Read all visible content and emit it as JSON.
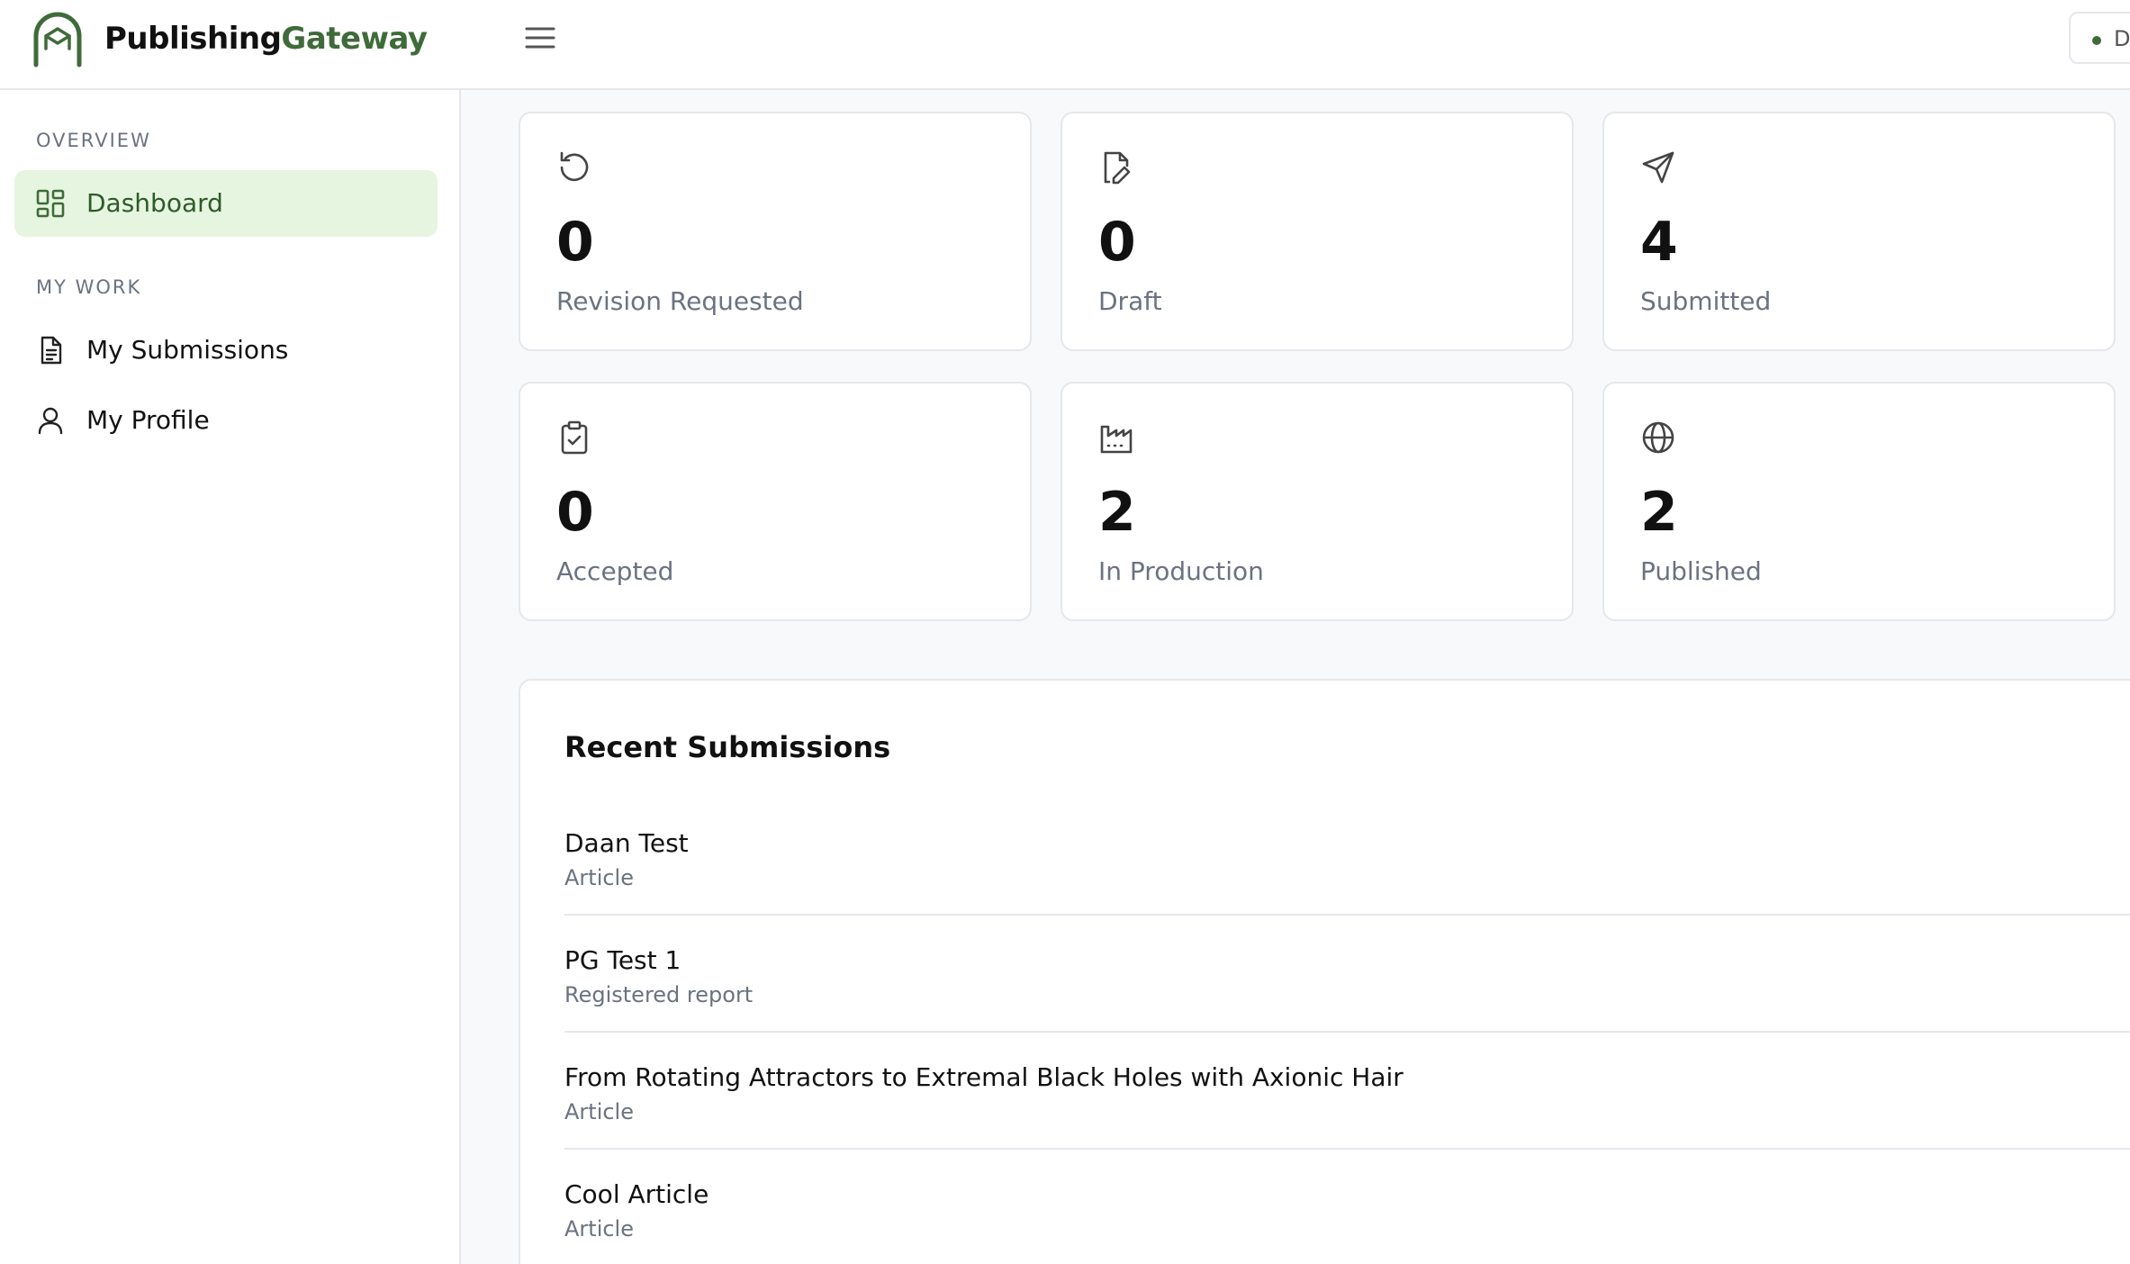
{
  "brand": {
    "name_part1": "Publishing",
    "name_part2": "Gateway",
    "accent": "#3f6b3a"
  },
  "header": {
    "status_text": "D"
  },
  "sidebar": {
    "sections": [
      {
        "label": "OVERVIEW",
        "items": [
          {
            "label": "Dashboard",
            "icon": "dashboard-grid-icon",
            "active": true
          }
        ]
      },
      {
        "label": "MY WORK",
        "items": [
          {
            "label": "My Submissions",
            "icon": "document-icon",
            "active": false
          },
          {
            "label": "My Profile",
            "icon": "user-icon",
            "active": false
          }
        ]
      }
    ]
  },
  "stats": [
    {
      "value": "0",
      "label": "Revision Requested",
      "icon": "rotate-ccw-icon"
    },
    {
      "value": "0",
      "label": "Draft",
      "icon": "file-pen-icon"
    },
    {
      "value": "4",
      "label": "Submitted",
      "icon": "send-icon"
    },
    {
      "value": "0",
      "label": "Accepted",
      "icon": "clipboard-check-icon"
    },
    {
      "value": "2",
      "label": "In Production",
      "icon": "factory-icon"
    },
    {
      "value": "2",
      "label": "Published",
      "icon": "globe-icon"
    }
  ],
  "recent": {
    "title": "Recent Submissions",
    "items": [
      {
        "title": "Daan Test",
        "type": "Article"
      },
      {
        "title": "PG Test 1",
        "type": "Registered report"
      },
      {
        "title": "From Rotating Attractors to Extremal Black Holes with Axionic Hair",
        "type": "Article"
      },
      {
        "title": "Cool Article",
        "type": "Article"
      }
    ]
  }
}
